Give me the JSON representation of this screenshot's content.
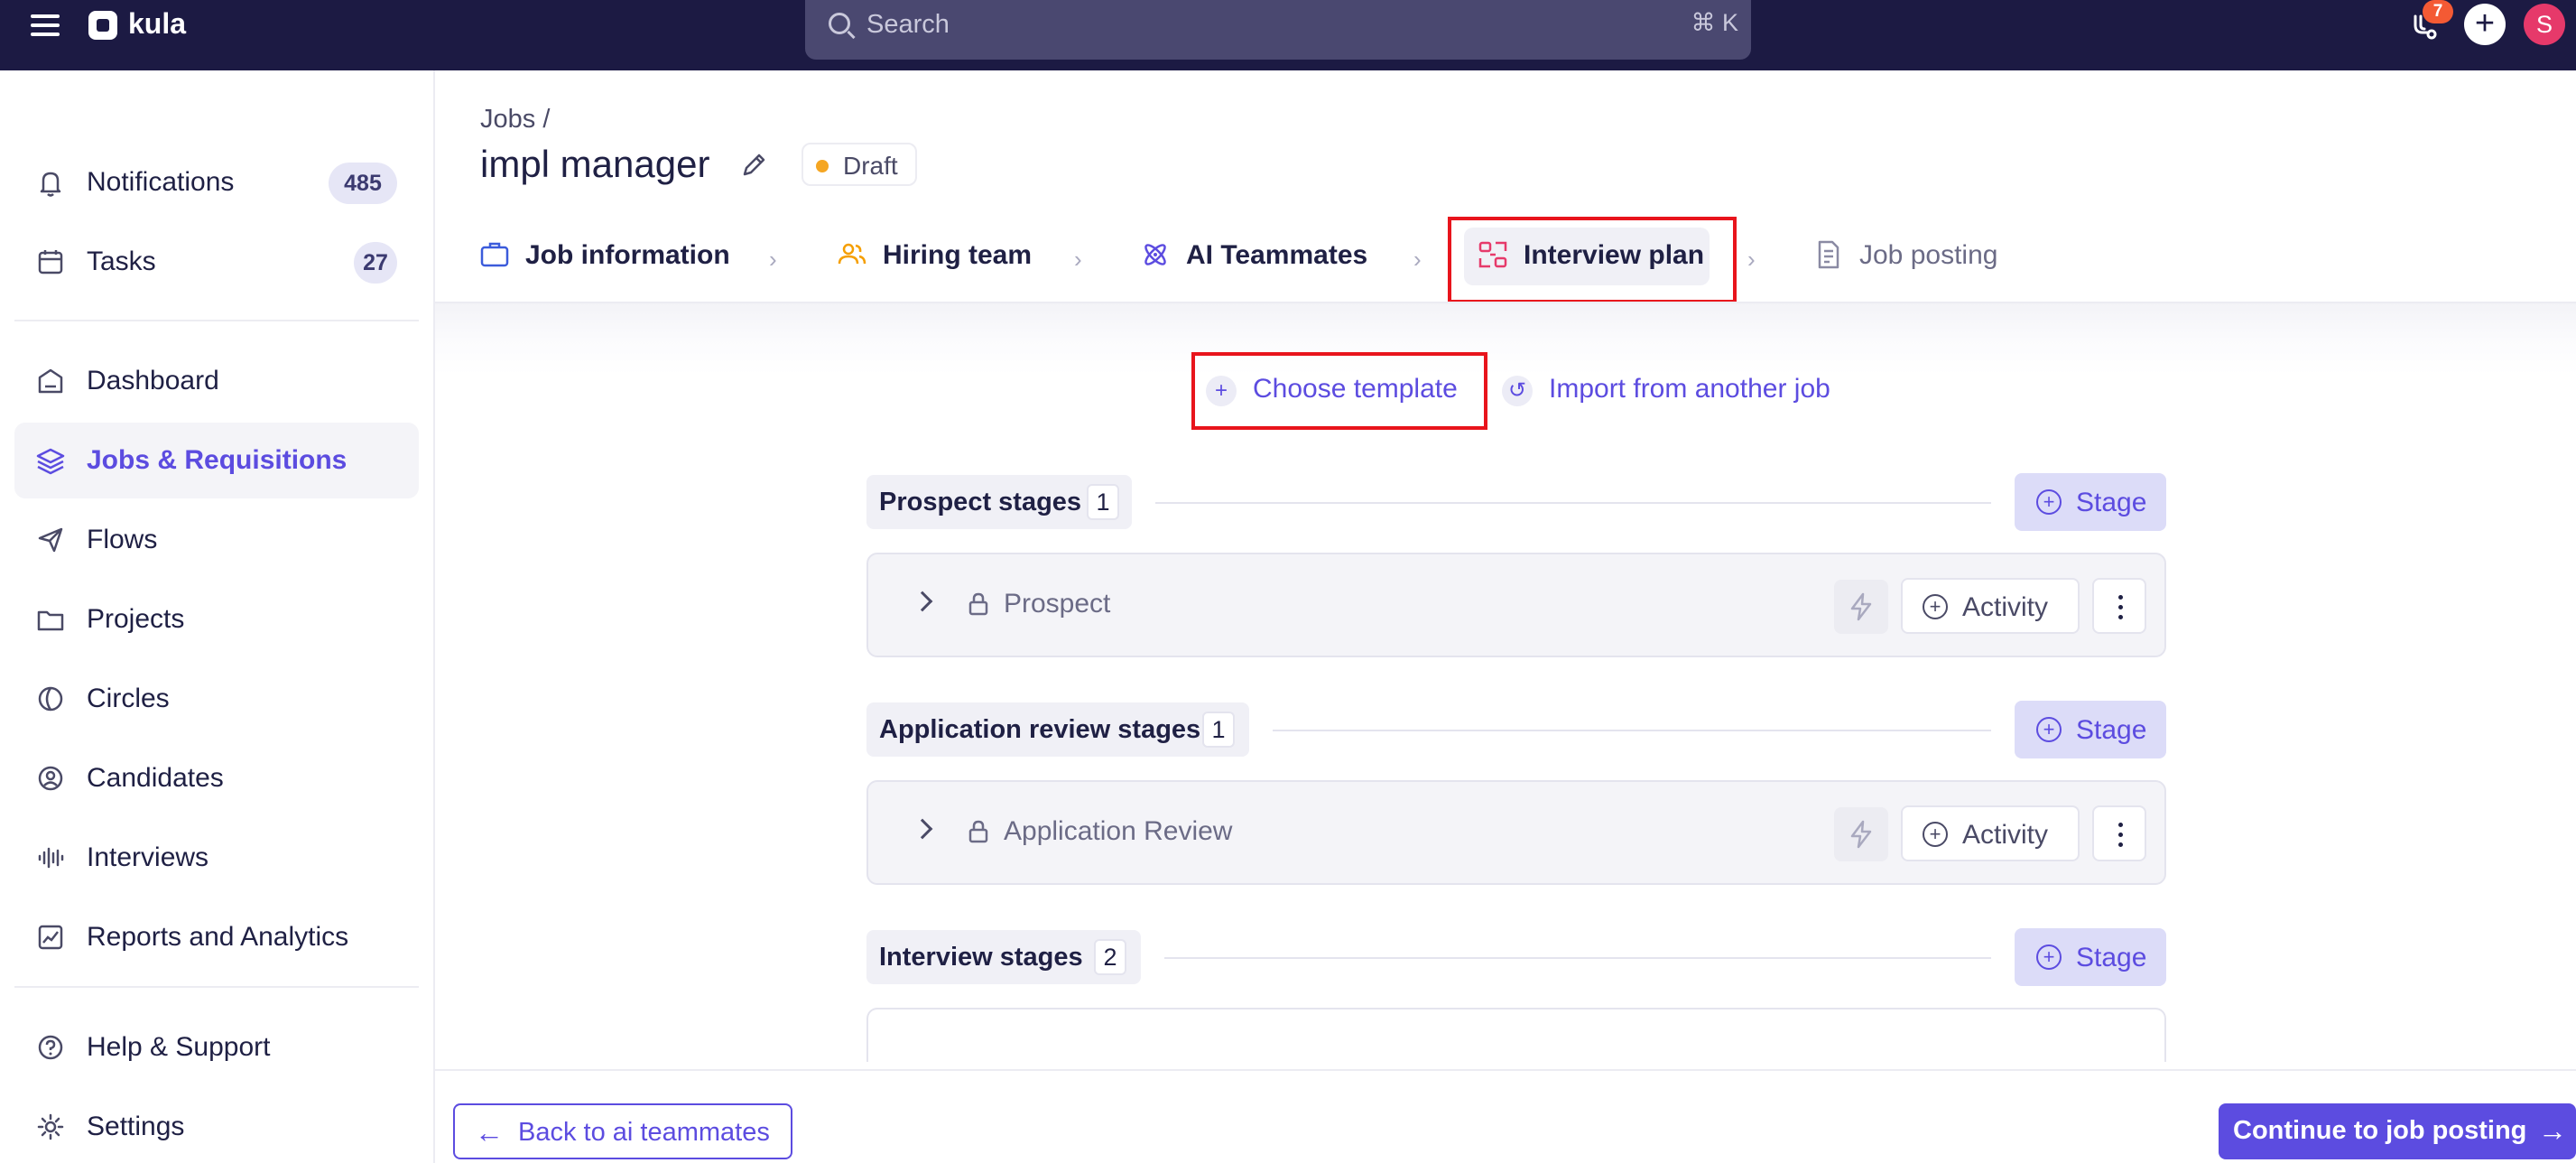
{
  "app": {
    "brand": "kula"
  },
  "topbar": {
    "search_placeholder": "Search",
    "search_shortcut": "⌘ K",
    "notification_badge": "7",
    "avatar_initial": "S",
    "colors": {
      "background": "#1c1a43",
      "badge": "#f45a34",
      "avatar": "#e6396a"
    }
  },
  "sidebar": {
    "items": [
      {
        "label": "Notifications",
        "icon": "bell-icon",
        "count": "485"
      },
      {
        "label": "Tasks",
        "icon": "calendar-icon",
        "count": "27"
      },
      {
        "label": "Dashboard",
        "icon": "home-icon"
      },
      {
        "label": "Jobs & Requisitions",
        "icon": "layers-icon",
        "active": true
      },
      {
        "label": "Flows",
        "icon": "send-icon"
      },
      {
        "label": "Projects",
        "icon": "folder-icon"
      },
      {
        "label": "Circles",
        "icon": "circles-icon"
      },
      {
        "label": "Candidates",
        "icon": "user-circle-icon"
      },
      {
        "label": "Interviews",
        "icon": "waveform-icon"
      },
      {
        "label": "Reports and Analytics",
        "icon": "chart-icon"
      },
      {
        "label": "Help & Support",
        "icon": "help-icon"
      },
      {
        "label": "Settings",
        "icon": "gear-icon"
      }
    ]
  },
  "header": {
    "breadcrumb": "Jobs /",
    "title": "impl manager",
    "status": "Draft",
    "status_color": "#f5a623"
  },
  "steps": [
    {
      "label": "Job information",
      "icon": "briefcase-icon",
      "color": "#3b5bdb"
    },
    {
      "label": "Hiring team",
      "icon": "users-icon",
      "color": "#f59f00"
    },
    {
      "label": "AI Teammates",
      "icon": "atom-icon",
      "color": "#5c4ce0"
    },
    {
      "label": "Interview plan",
      "icon": "interview-plan-icon",
      "color": "#e6396a",
      "active": true
    },
    {
      "label": "Job posting",
      "icon": "document-icon",
      "color": "#8a8aa3",
      "disabled": true
    }
  ],
  "template_actions": {
    "choose_template": "Choose template",
    "import_job": "Import from another job"
  },
  "sections": [
    {
      "title": "Prospect stages",
      "count": "1",
      "add_label": "Stage",
      "stages": [
        {
          "name": "Prospect",
          "activity_label": "Activity"
        }
      ]
    },
    {
      "title": "Application review stages",
      "count": "1",
      "add_label": "Stage",
      "stages": [
        {
          "name": "Application Review",
          "activity_label": "Activity"
        }
      ]
    },
    {
      "title": "Interview stages",
      "count": "2",
      "add_label": "Stage"
    }
  ],
  "footer": {
    "back_label": "Back to ai teammates",
    "continue_label": "Continue to job posting"
  },
  "accent_color": "#5c4ce0"
}
